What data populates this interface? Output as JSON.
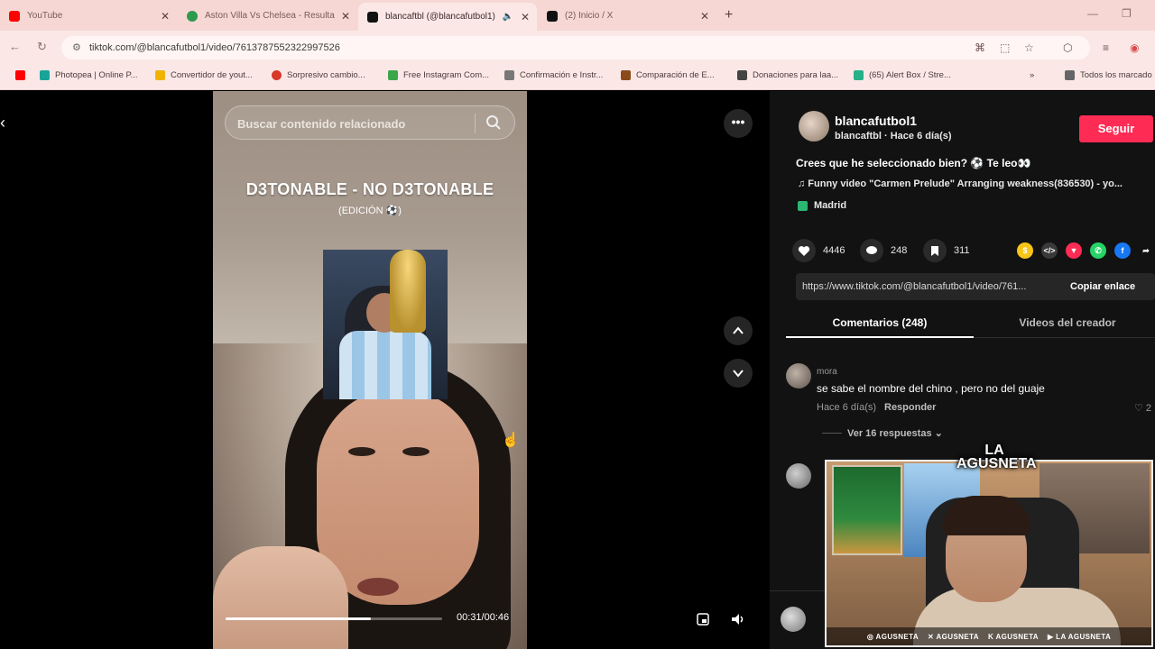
{
  "browser": {
    "tabs": [
      {
        "title": "YouTube",
        "color": "#ff0000"
      },
      {
        "title": "Aston Villa Vs Chelsea - Resulta",
        "color": "#2e9a4d"
      },
      {
        "title": "blancaftbl (@blancafutbol1)",
        "color": "#111111"
      },
      {
        "title": "(2) Inicio / X",
        "color": "#111111"
      }
    ],
    "url": "tiktok.com/@blancafutbol1/video/7613787552322997526",
    "bookmarks": [
      {
        "label": "Photopea | Online P...",
        "color": "#18a497"
      },
      {
        "label": "Convertidor de yout...",
        "color": "#f0b400"
      },
      {
        "label": "Sorpresivo cambio...",
        "color": "#d8372a"
      },
      {
        "label": "Free Instagram Com...",
        "color": "#3aa64a"
      },
      {
        "label": "Confirmación e Instr...",
        "color": "#777777"
      },
      {
        "label": "Comparación de E...",
        "color": "#8a4a1a"
      },
      {
        "label": "Donaciones para laa...",
        "color": "#444444"
      },
      {
        "label": "(65) Alert Box / Stre...",
        "color": "#26b08a"
      },
      {
        "label": "Todos los marcado",
        "color": "#666666"
      }
    ]
  },
  "video": {
    "search_placeholder": "Buscar contenido relacionado",
    "title": "D3TONABLE - NO D3TONABLE",
    "subtitle": "(EDICIÓN ⚽)",
    "time": "00:31/00:46",
    "progress": 0.67
  },
  "post": {
    "username": "blancafutbol1",
    "subline": "blancaftbl · Hace 6 día(s)",
    "follow_label": "Seguir",
    "caption": "Crees que he seleccionado bien? ⚽ Te leo👀",
    "music": "♫  Funny video \"Carmen Prelude\" Arranging weakness(836530) - yo...",
    "location": "Madrid",
    "likes": "4446",
    "comments": "248",
    "saves": "311",
    "link": "https://www.tiktok.com/@blancafutbol1/video/761...",
    "copy_label": "Copiar enlace",
    "tab_comments": "Comentarios (248)",
    "tab_creator": "Videos del creador"
  },
  "comment": {
    "user": "mora",
    "text": "se sabe el nombre del chino , pero no del guaje",
    "meta": "Hace 6 día(s)",
    "reply": "Responder",
    "likes": "2",
    "view_replies": "Ver 16 respuestas"
  },
  "webcam": {
    "logo": "LA AGUSNETA",
    "social": [
      "AGUSNETA",
      "AGUSNETA",
      "AGUSNETA",
      "LA AGUSNETA"
    ]
  },
  "share_colors": [
    "#f5c518",
    "#3a3a3a",
    "#fe2c55",
    "#25d366",
    "#1877f2"
  ]
}
